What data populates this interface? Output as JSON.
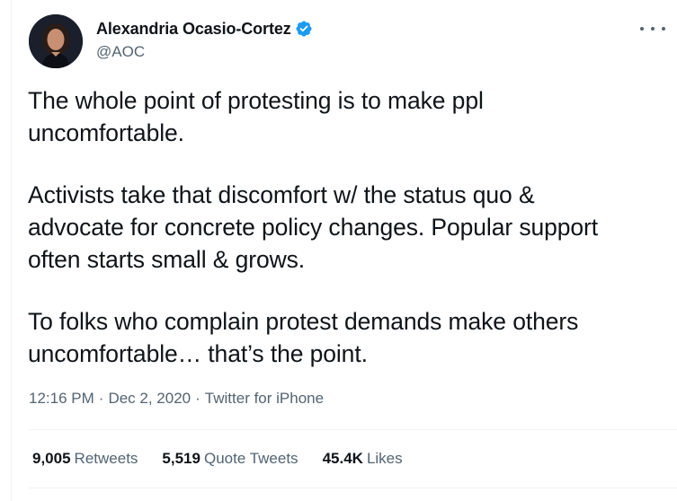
{
  "author": {
    "display_name": "Alexandria Ocasio-Cortez",
    "handle": "@AOC",
    "verified": true
  },
  "tweet": {
    "paragraphs": [
      "The whole point of protesting is to make ppl\nuncomfortable.",
      "Activists take that discomfort w/ the status quo &\nadvocate for concrete policy changes. Popular support\noften starts small & grows.",
      "To folks who complain protest demands make others\nuncomfortable… that’s the point."
    ]
  },
  "meta": {
    "time": "12:16 PM",
    "separator": "·",
    "date": "Dec 2, 2020",
    "source": "Twitter for iPhone"
  },
  "stats": {
    "retweets": {
      "count": "9,005",
      "label": "Retweets"
    },
    "quote_tweets": {
      "count": "5,519",
      "label": "Quote Tweets"
    },
    "likes": {
      "count": "45.4K",
      "label": "Likes"
    }
  },
  "colors": {
    "verified_badge": "#1d9bf0",
    "primary_text": "#0f1419",
    "secondary_text": "#536471",
    "divider": "#eff3f4"
  },
  "icons": {
    "verified": "verified-badge-icon",
    "more": "more-options-icon"
  }
}
